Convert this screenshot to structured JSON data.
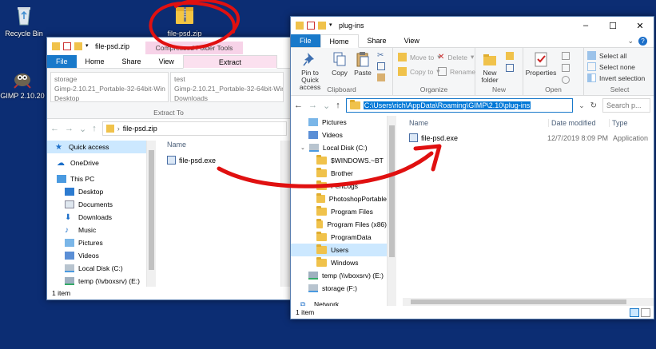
{
  "desktop": {
    "icons": [
      {
        "label": "Recycle Bin",
        "icon": "recycle-bin-icon"
      },
      {
        "label": "GIMP 2.10.20",
        "icon": "gimp-icon"
      }
    ],
    "dragged_file": {
      "label": "file-psd.zip",
      "icon": "zip-folder-icon"
    },
    "annotation_color": "#e01010"
  },
  "left_window": {
    "title": "file-psd.zip",
    "context_tab_group": "Compressed Folder Tools",
    "tabs": [
      "File",
      "Home",
      "Share",
      "View",
      "Extract"
    ],
    "active_tab": "Extract",
    "extract_to_list": [
      {
        "label": "storage"
      },
      {
        "label": "Gimp-2.10.21_Portable-32-64bit-Win"
      },
      {
        "label": "Desktop"
      },
      {
        "label": "test"
      },
      {
        "label": "Gimp-2.10.21_Portable-32-64bit-Win"
      },
      {
        "label": "Downloads"
      }
    ],
    "ribbon_group_label": "Extract To",
    "address": {
      "path": "file-psd.zip",
      "separator": "›"
    },
    "nav": [
      {
        "label": "Quick access",
        "icon": "star-icon",
        "selected": true
      },
      {
        "label": "OneDrive",
        "icon": "cloud-icon"
      },
      {
        "label": "This PC",
        "icon": "computer-icon"
      },
      {
        "label": "Desktop",
        "icon": "desktop-icon"
      },
      {
        "label": "Documents",
        "icon": "documents-icon"
      },
      {
        "label": "Downloads",
        "icon": "download-icon"
      },
      {
        "label": "Music",
        "icon": "music-icon"
      },
      {
        "label": "Pictures",
        "icon": "pictures-icon"
      },
      {
        "label": "Videos",
        "icon": "videos-icon"
      },
      {
        "label": "Local Disk (C:)",
        "icon": "drive-icon"
      },
      {
        "label": "temp (\\\\vboxsrv) (E:)",
        "icon": "network-drive-icon"
      }
    ],
    "column_name": "Name",
    "files": [
      {
        "name": "file-psd.exe",
        "icon": "exe-icon"
      }
    ],
    "status": "1 item"
  },
  "right_window": {
    "title": "plug-ins",
    "tabs": [
      "File",
      "Home",
      "Share",
      "View"
    ],
    "active_tab": "Home",
    "ribbon": {
      "clipboard": {
        "label": "Clipboard",
        "pin": "Pin to Quick access",
        "copy": "Copy",
        "paste": "Paste"
      },
      "organize": {
        "label": "Organize",
        "move_to": "Move to",
        "copy_to": "Copy to",
        "delete": "Delete",
        "rename": "Rename"
      },
      "new": {
        "label": "New",
        "new_folder": "New folder"
      },
      "open": {
        "label": "Open",
        "properties": "Properties"
      },
      "select": {
        "label": "Select",
        "select_all": "Select all",
        "select_none": "Select none",
        "invert": "Invert selection"
      }
    },
    "address": {
      "path": "C:\\Users\\rich\\AppData\\Roaming\\GIMP\\2.10\\plug-ins"
    },
    "search_placeholder": "Search p...",
    "nav": [
      {
        "label": "Pictures",
        "icon": "pictures-icon"
      },
      {
        "label": "Videos",
        "icon": "videos-icon"
      },
      {
        "label": "Local Disk (C:)",
        "icon": "drive-icon"
      },
      {
        "label": "$WINDOWS.~BT",
        "icon": "folder-icon"
      },
      {
        "label": "Brother",
        "icon": "folder-icon"
      },
      {
        "label": "PerfLogs",
        "icon": "folder-icon"
      },
      {
        "label": "PhotoshopPortable",
        "icon": "folder-icon"
      },
      {
        "label": "Program Files",
        "icon": "folder-icon"
      },
      {
        "label": "Program Files (x86)",
        "icon": "folder-icon"
      },
      {
        "label": "ProgramData",
        "icon": "folder-icon"
      },
      {
        "label": "Users",
        "icon": "folder-icon",
        "selected": true
      },
      {
        "label": "Windows",
        "icon": "folder-icon"
      },
      {
        "label": "temp (\\\\vboxsrv) (E:)",
        "icon": "network-drive-icon"
      },
      {
        "label": "storage (F:)",
        "icon": "drive-icon"
      },
      {
        "label": "Network",
        "icon": "network-icon"
      }
    ],
    "columns": [
      "Name",
      "Date modified",
      "Type"
    ],
    "files": [
      {
        "name": "file-psd.exe",
        "date": "12/7/2019 8:09 PM",
        "type": "Application",
        "icon": "exe-icon"
      }
    ],
    "status": "1 item"
  }
}
